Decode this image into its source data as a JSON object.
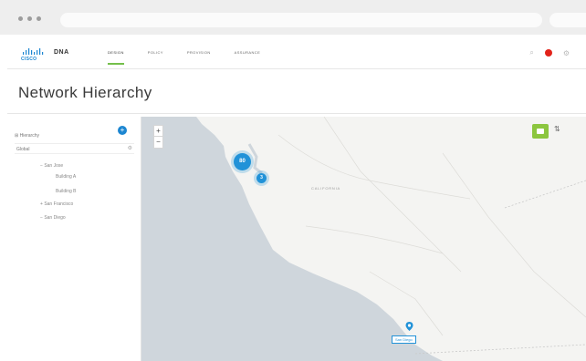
{
  "app": {
    "brand": "DNA",
    "logo_text": "CISCO"
  },
  "nav": {
    "items": [
      {
        "label": "DESIGN",
        "active": true
      },
      {
        "label": "POLICY",
        "active": false
      },
      {
        "label": "PROVISION",
        "active": false
      },
      {
        "label": "ASSURANCE",
        "active": false
      }
    ]
  },
  "page": {
    "title": "Network Hierarchy"
  },
  "sidebar": {
    "header_label": "Hierarchy",
    "root": "Global",
    "tree": [
      {
        "label": "San Jose",
        "expanded": true
      },
      {
        "label": "Building A"
      },
      {
        "label": "Building B"
      },
      {
        "label": "San Francisco",
        "expanded": false
      },
      {
        "label": "San Diego",
        "expanded": true
      }
    ]
  },
  "map": {
    "zoom_in": "+",
    "zoom_out": "−",
    "clusters": [
      {
        "count": "80"
      },
      {
        "count": "3"
      }
    ],
    "places": [
      {
        "label": "San Diego"
      },
      {
        "label": "CALIFORNIA"
      }
    ]
  },
  "colors": {
    "accent": "#1c86d1",
    "active_tab": "#74bf4b",
    "toggle": "#8cc63f",
    "alert": "#e2231a",
    "ocean": "#cfd6dc",
    "land": "#f4f4f2"
  }
}
